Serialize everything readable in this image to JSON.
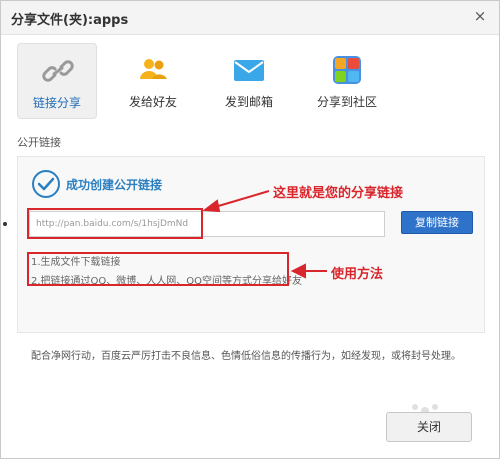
{
  "dialog": {
    "title": "分享文件(夹):apps",
    "close_glyph": "×"
  },
  "tabs": [
    {
      "label": "链接分享",
      "icon": "chain-link-icon",
      "active": true
    },
    {
      "label": "发给好友",
      "icon": "friends-icon",
      "active": false
    },
    {
      "label": "发到邮箱",
      "icon": "mail-icon",
      "active": false
    },
    {
      "label": "分享到社区",
      "icon": "community-icon",
      "active": false
    }
  ],
  "section_label": "公开链接",
  "success_text": "成功创建公开链接",
  "link_field": {
    "value": "http://pan.baidu.com/s/1hsjDmNd"
  },
  "copy_button": "复制链接",
  "methods": [
    "1.生成文件下载链接",
    "2.把链接通过QQ、微博、人人网、QQ空间等方式分享给好友"
  ],
  "annotations": {
    "link": "这里就是您的分享链接",
    "method": "使用方法",
    "color": "#d9262c"
  },
  "notice": "配合净网行动，百度云严厉打击不良信息、色情低俗信息的传播行为，如经发现，或将封号处理。",
  "bottom_button": "关闭",
  "colors": {
    "accent": "#2e73c9",
    "link_text": "#2a7fc1",
    "annotation": "#d9262c"
  }
}
